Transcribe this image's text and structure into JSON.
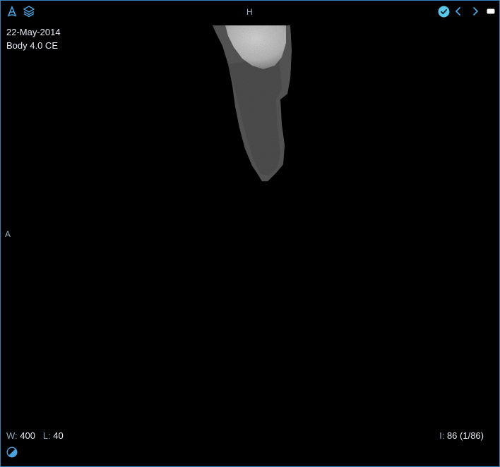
{
  "viewport": {
    "study_date": "22-May-2014",
    "series_description": "Body 4.0 CE",
    "orientation_top": "H",
    "orientation_left": "A",
    "window_label": "W:",
    "window_value": "400",
    "level_label": "L:",
    "level_value": "40",
    "instance_label": "I:",
    "instance_value": "86 (1/86)"
  },
  "icons": {
    "top_left": [
      "patient-orientation-icon",
      "layers-icon"
    ],
    "top_right": [
      "status-check-icon",
      "prev-arrow-icon",
      "next-arrow-icon",
      "toggle-icon"
    ],
    "bottom_left": "contrast-icon"
  },
  "colors": {
    "accent": "#4aa3df",
    "border": "#3a7fb5",
    "check": "#5cc6e8"
  }
}
